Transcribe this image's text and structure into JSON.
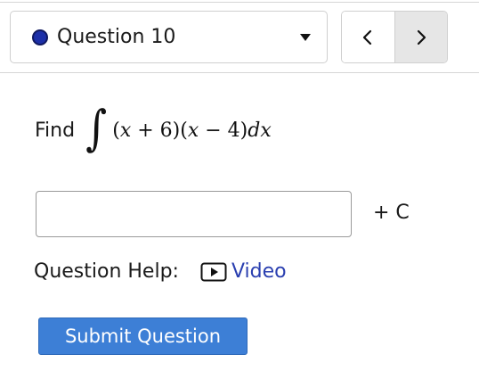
{
  "question_nav": {
    "label": "Question 10",
    "status_color": "#1c2fa8",
    "dropdown_icon": "caret-down-icon",
    "prev_icon": "chevron-left-icon",
    "next_icon": "chevron-right-icon"
  },
  "prompt": {
    "find_word": "Find",
    "integrand_parts": [
      "(",
      "x",
      " + 6)(",
      "x",
      " − 4)",
      "dx"
    ]
  },
  "answer": {
    "value": "",
    "suffix": "+ C"
  },
  "help": {
    "label": "Question Help:",
    "video_label": "Video",
    "video_icon": "play-box-icon",
    "link_color": "#2a3fb0"
  },
  "submit": {
    "label": "Submit Question",
    "color": "#3d7fd6"
  }
}
